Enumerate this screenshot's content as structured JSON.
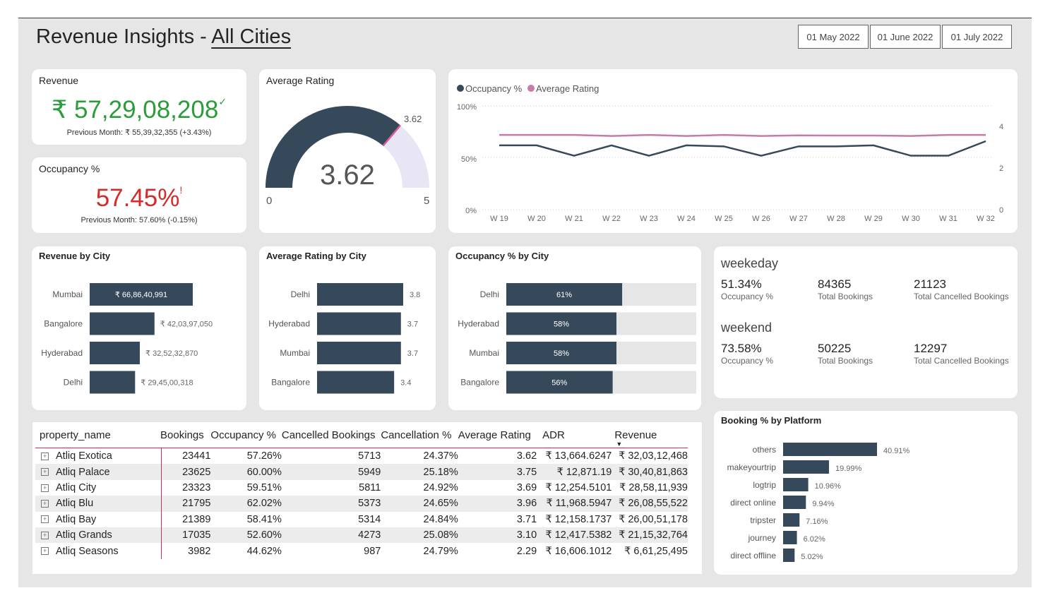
{
  "header": {
    "title_prefix": "Revenue Insights - ",
    "title_city": "All Cities",
    "dates": [
      "01 May 2022",
      "01 June 2022",
      "01 July 2022"
    ]
  },
  "revenue_card": {
    "title": "Revenue",
    "value": "₹ 57,29,08,208",
    "trend_icon": "check",
    "previous": "Previous Month: ₹ 55,39,32,355 (+3.43%)",
    "value_color": "#2a9d3a"
  },
  "occupancy_card": {
    "title": "Occupancy %",
    "value": "57.45%",
    "alert_mark": "!",
    "previous": "Previous Month: 57.60% (-0.15%)",
    "value_color": "#d42a2a"
  },
  "rating_card": {
    "title": "Average Rating",
    "value": "3.62",
    "target_label": "3.62",
    "min": "0",
    "max": "5",
    "gauge_value": 3.62,
    "gauge_max": 5
  },
  "trend_chart": {
    "legend": [
      {
        "name": "Occupancy %",
        "color": "#36495a"
      },
      {
        "name": "Average Rating",
        "color": "#c87aa8"
      }
    ],
    "y_left_ticks": [
      "100%",
      "50%",
      "0%"
    ],
    "y_right_ticks": [
      "4",
      "2",
      "0"
    ]
  },
  "chart_data": [
    {
      "type": "line",
      "x": [
        "W 19",
        "W 20",
        "W 21",
        "W 22",
        "W 23",
        "W 24",
        "W 25",
        "W 26",
        "W 27",
        "W 28",
        "W 29",
        "W 30",
        "W 31",
        "W 32"
      ],
      "series": [
        {
          "name": "Occupancy %",
          "axis": "left",
          "values": [
            62,
            62,
            52,
            62,
            52,
            62,
            61,
            52,
            61,
            61,
            62,
            52,
            52,
            66
          ]
        },
        {
          "name": "Average Rating",
          "axis": "right",
          "values": [
            3.6,
            3.6,
            3.6,
            3.55,
            3.6,
            3.55,
            3.6,
            3.55,
            3.58,
            3.57,
            3.57,
            3.55,
            3.6,
            3.6
          ]
        }
      ],
      "ylim_left": [
        0,
        100
      ],
      "ylim_right": [
        0,
        5
      ]
    },
    {
      "type": "bar",
      "title": "Revenue by City",
      "categories": [
        "Mumbai",
        "Bangalore",
        "Hyderabad",
        "Delhi"
      ],
      "values": [
        668640991,
        420397050,
        325232870,
        294500318
      ],
      "data_labels": [
        "₹ 66,86,40,991",
        "₹ 42,03,97,050",
        "₹ 32,52,32,870",
        "₹ 29,45,00,318"
      ]
    },
    {
      "type": "bar",
      "title": "Average Rating by City",
      "categories": [
        "Delhi",
        "Hyderabad",
        "Mumbai",
        "Bangalore"
      ],
      "values": [
        3.8,
        3.7,
        3.7,
        3.4
      ],
      "data_labels": [
        "3.8",
        "3.7",
        "3.7",
        "3.4"
      ]
    },
    {
      "type": "bar",
      "title": "Occupancy % by City",
      "categories": [
        "Delhi",
        "Hyderabad",
        "Mumbai",
        "Bangalore"
      ],
      "values": [
        61,
        58,
        58,
        56
      ],
      "data_labels": [
        "61%",
        "58%",
        "58%",
        "56%"
      ]
    },
    {
      "type": "bar",
      "title": "Booking % by Platform",
      "categories": [
        "others",
        "makeyourtrip",
        "logtrip",
        "direct online",
        "tripster",
        "journey",
        "direct offline"
      ],
      "values": [
        40.91,
        19.99,
        10.96,
        9.94,
        7.16,
        6.02,
        5.02
      ],
      "data_labels": [
        "40.91%",
        "19.99%",
        "10.96%",
        "9.94%",
        "7.16%",
        "6.02%",
        "5.02%"
      ]
    }
  ],
  "daytype": {
    "weekeday": {
      "label": "weekeday",
      "occupancy": "51.34%",
      "occupancy_label": "Occupancy %",
      "bookings": "84365",
      "bookings_label": "Total Bookings",
      "cancelled": "21123",
      "cancelled_label": "Total Cancelled Bookings"
    },
    "weekend": {
      "label": "weekend",
      "occupancy": "73.58%",
      "occupancy_label": "Occupancy %",
      "bookings": "50225",
      "bookings_label": "Total Bookings",
      "cancelled": "12297",
      "cancelled_label": "Total Cancelled Bookings"
    }
  },
  "table": {
    "headers": [
      "property_name",
      "Bookings",
      "Occupancy %",
      "Cancelled Bookings",
      "Cancellation %",
      "Average Rating",
      "ADR",
      "Revenue"
    ],
    "rows": [
      [
        "Atliq Exotica",
        "23441",
        "57.26%",
        "5713",
        "24.37%",
        "3.62",
        "₹ 13,664.6247",
        "₹ 32,03,12,468"
      ],
      [
        "Atliq Palace",
        "23625",
        "60.00%",
        "5949",
        "25.18%",
        "3.75",
        "₹ 12,871.19",
        "₹ 30,40,81,863"
      ],
      [
        "Atliq City",
        "23323",
        "59.51%",
        "5811",
        "24.92%",
        "3.69",
        "₹ 12,254.5101",
        "₹ 28,58,11,939"
      ],
      [
        "Atliq Blu",
        "21795",
        "62.02%",
        "5373",
        "24.65%",
        "3.96",
        "₹ 11,968.5947",
        "₹ 26,08,55,522"
      ],
      [
        "Atliq Bay",
        "21389",
        "58.41%",
        "5314",
        "24.84%",
        "3.71",
        "₹ 12,158.1737",
        "₹ 26,00,51,178"
      ],
      [
        "Atliq Grands",
        "17035",
        "52.60%",
        "4273",
        "25.08%",
        "3.10",
        "₹ 12,417.5382",
        "₹ 21,15,32,764"
      ],
      [
        "Atliq Seasons",
        "3982",
        "44.62%",
        "987",
        "24.79%",
        "2.29",
        "₹ 16,606.1012",
        "₹ 6,61,25,495"
      ]
    ]
  }
}
